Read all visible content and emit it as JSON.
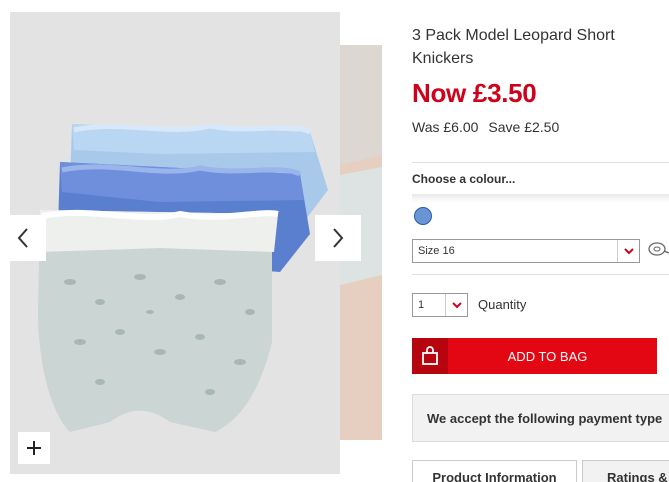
{
  "product": {
    "title": "3 Pack Model Leopard Short Knickers",
    "price_now": "Now £3.50",
    "price_was": "Was £6.00",
    "price_save": "Save £2.50"
  },
  "colour": {
    "label": "Choose a colour...",
    "swatch_color": "#6a95d4"
  },
  "size": {
    "selected": "Size 16"
  },
  "quantity": {
    "selected": "1",
    "label": "Quantity"
  },
  "add_to_bag": {
    "label": "ADD TO BAG"
  },
  "payment": {
    "text": "We accept the following payment type"
  },
  "tabs": [
    {
      "label": "Product Information"
    },
    {
      "label": "Ratings &"
    }
  ],
  "colors": {
    "accent": "#e30613",
    "price": "#d0021b"
  },
  "icons": [
    "chevron-left-icon",
    "chevron-right-icon",
    "zoom-plus-icon",
    "caret-down-icon",
    "shopping-bag-icon",
    "tape-measure-icon"
  ]
}
